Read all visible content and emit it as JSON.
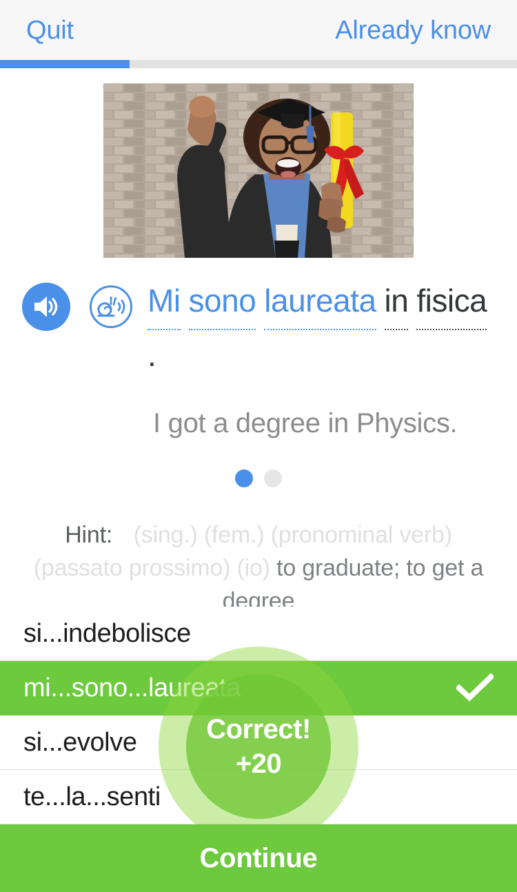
{
  "header": {
    "quit_label": "Quit",
    "already_know_label": "Already know"
  },
  "progress": {
    "percent": 25
  },
  "media": {
    "alt": "graduate-celebrating-photo"
  },
  "audio": {
    "normal_icon": "speaker-icon",
    "slow_icon": "snail-speaker-icon"
  },
  "prompt": {
    "words": [
      {
        "text": "Mi",
        "highlight": true,
        "dotted": true
      },
      {
        "text": "sono",
        "highlight": true,
        "dotted": true
      },
      {
        "text": "laureata",
        "highlight": true,
        "dotted": true
      },
      {
        "text": "in",
        "highlight": false,
        "dotted": true
      },
      {
        "text": "fisica",
        "highlight": false,
        "dotted": true
      },
      {
        "text": ".",
        "highlight": false,
        "dotted": false
      }
    ],
    "sentence": "Mi sono laureata in fisica .",
    "translation": "I got a degree in Physics."
  },
  "pager": {
    "total": 2,
    "active_index": 0
  },
  "hint": {
    "label": "Hint:",
    "grammar": "(sing.) (fem.) (pronominal verb) (passato prossimo) (io)",
    "definition": "to graduate; to get a degree"
  },
  "options": [
    {
      "label": "si...indebolisce",
      "state": "normal",
      "check": ""
    },
    {
      "label": "mi...sono...laureata",
      "state": "correct",
      "check": "✓"
    },
    {
      "label": "si...evolve",
      "state": "normal",
      "check": ""
    },
    {
      "label": "te...la...senti",
      "state": "normal",
      "check": ""
    }
  ],
  "feedback": {
    "title": "Correct!",
    "points": "+20"
  },
  "footer": {
    "continue_label": "Continue"
  },
  "colors": {
    "accent_blue": "#4a90e8",
    "correct_green": "#6dc93e",
    "track_gray": "#e2e2e2",
    "topbar_bg": "#f7f7f7"
  }
}
